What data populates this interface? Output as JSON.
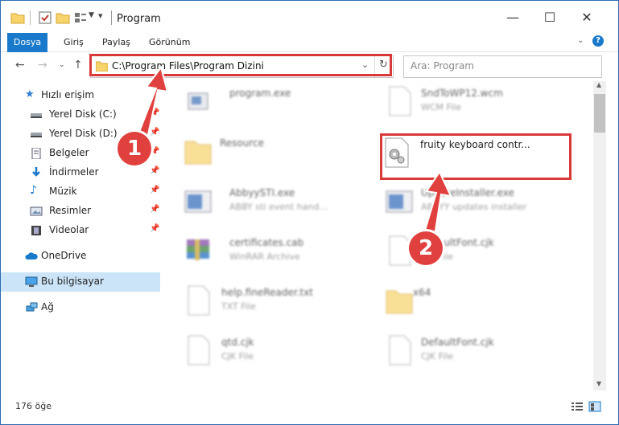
{
  "window": {
    "title": "Program"
  },
  "ribbon": {
    "tabs": [
      "Dosya",
      "Giriş",
      "Paylaş",
      "Görünüm"
    ]
  },
  "address": {
    "path": "C:\\Program Files\\Program Dizini"
  },
  "search": {
    "placeholder": "Ara: Program"
  },
  "nav": {
    "items": [
      {
        "label": "Hızlı erişim",
        "icon": "star-icon"
      },
      {
        "label": "Yerel Disk (C:)",
        "icon": "drive-icon",
        "pinned": true
      },
      {
        "label": "Yerel Disk (D:)",
        "icon": "drive-icon",
        "pinned": true
      },
      {
        "label": "Belgeler",
        "icon": "document-icon",
        "pinned": true
      },
      {
        "label": "İndirmeler",
        "icon": "download-icon",
        "pinned": true
      },
      {
        "label": "Müzik",
        "icon": "music-icon",
        "pinned": true
      },
      {
        "label": "Resimler",
        "icon": "pictures-icon",
        "pinned": true
      },
      {
        "label": "Videolar",
        "icon": "video-icon",
        "pinned": true
      },
      {
        "label": "OneDrive",
        "icon": "cloud-icon"
      },
      {
        "label": "Bu bilgisayar",
        "icon": "computer-icon"
      },
      {
        "label": "Ağ",
        "icon": "network-icon"
      }
    ]
  },
  "files": [
    {
      "name": "program.exe",
      "type": ""
    },
    {
      "name": "SndToWP12.wcm",
      "type": "WCM File"
    },
    {
      "name": "Resource",
      "type": ""
    },
    {
      "name": "fruity keyboard contr...",
      "type": ""
    },
    {
      "name": "AbbyySTI.exe",
      "type": "ABBY sti event hand..."
    },
    {
      "name": "UpdateInstaller.exe",
      "type": "ABBYY updates installer"
    },
    {
      "name": "certificates.cab",
      "type": "WinRAR Archive"
    },
    {
      "name": "DefaultFont.cjk",
      "type": "CJK File"
    },
    {
      "name": "help.fineReader.txt",
      "type": "TXT File"
    },
    {
      "name": "x64",
      "type": ""
    },
    {
      "name": "qtd.cjk",
      "type": "CJK File"
    },
    {
      "name": "DefaultFont.cjk",
      "type": "CJK File"
    }
  ],
  "status": {
    "count": "176 öğe"
  },
  "annotations": {
    "step1": "1",
    "step2": "2"
  },
  "colors": {
    "accent": "#1979ca",
    "annotation": "#d83a3a",
    "selected": "#cce4f7"
  }
}
